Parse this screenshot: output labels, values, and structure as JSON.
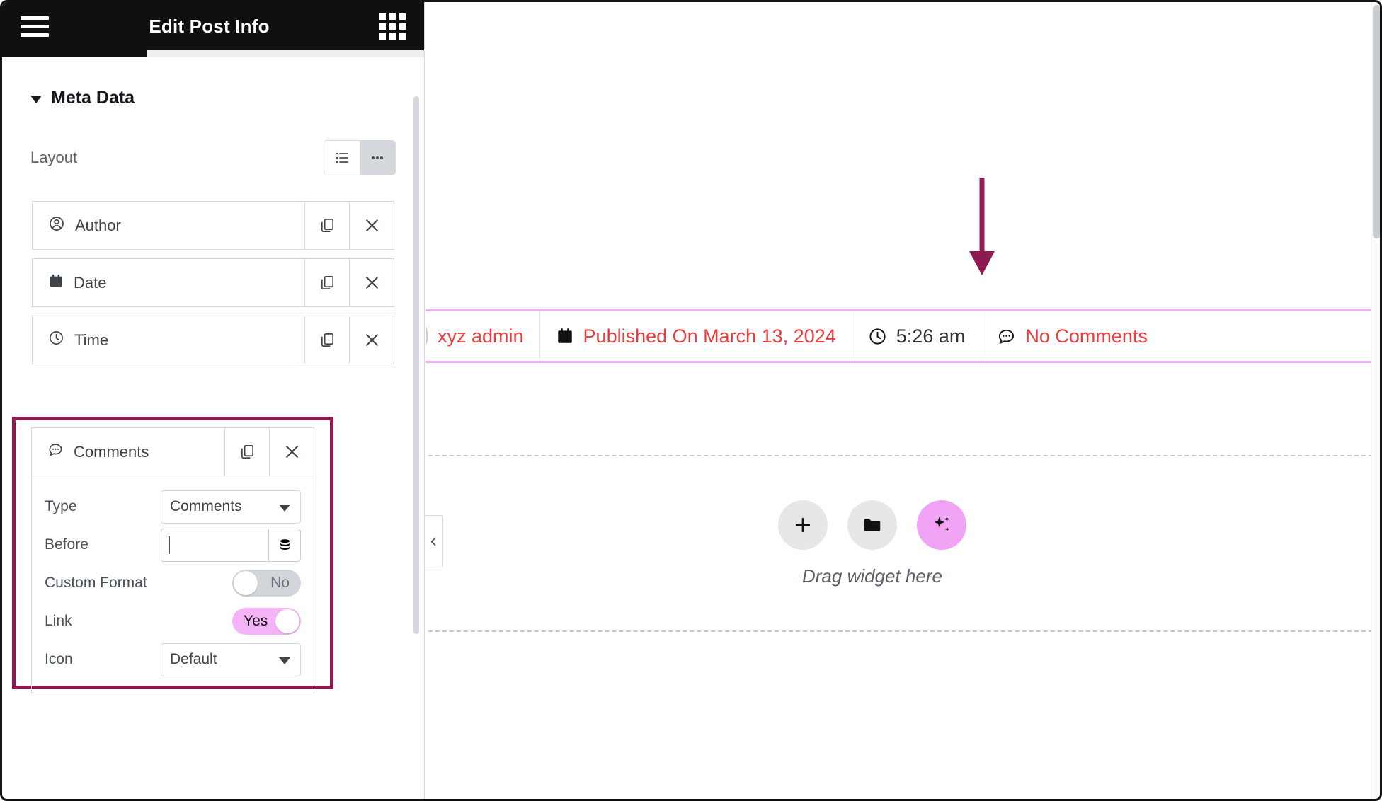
{
  "panel": {
    "header": {
      "title": "Edit Post Info",
      "menu_icon": "hamburger-icon",
      "apps_icon": "grid-apps-icon"
    },
    "section": {
      "title": "Meta Data",
      "collapse_icon": "caret-down-icon"
    },
    "layout_control": {
      "label": "Layout",
      "options": [
        {
          "name": "list-layout",
          "icon": "list-icon",
          "active": false
        },
        {
          "name": "inline-layout",
          "icon": "ellipsis-icon",
          "active": true
        }
      ]
    },
    "repeater_items": [
      {
        "label": "Author",
        "icon": "user-circle-icon",
        "duplicate": "duplicate-icon",
        "remove": "close-icon"
      },
      {
        "label": "Date",
        "icon": "calendar-icon",
        "duplicate": "duplicate-icon",
        "remove": "close-icon"
      },
      {
        "label": "Time",
        "icon": "clock-icon",
        "duplicate": "duplicate-icon",
        "remove": "close-icon"
      },
      {
        "label": "Comments",
        "icon": "comment-icon",
        "duplicate": "duplicate-icon",
        "remove": "close-icon"
      }
    ],
    "comments_settings": {
      "type": {
        "label": "Type",
        "value": "Comments"
      },
      "before": {
        "label": "Before",
        "value": "",
        "placeholder": "",
        "dynamic_icon": "database-icon"
      },
      "custom_format": {
        "label": "Custom Format",
        "value": "No",
        "on": false
      },
      "link": {
        "label": "Link",
        "value": "Yes",
        "on": true
      },
      "icon": {
        "label": "Icon",
        "value": "Default"
      }
    },
    "highlight_color": "#8e1a51",
    "collapse_handle_icon": "chevron-left-icon"
  },
  "canvas": {
    "annotation": {
      "type": "arrow-down",
      "color": "#8e1a51"
    },
    "meta_bar": {
      "outline_color": "#f0b0f5",
      "items": [
        {
          "name": "author",
          "icon": "avatar-image",
          "text": "xyz admin",
          "color": "#ef3b3b"
        },
        {
          "name": "date",
          "icon": "calendar-icon",
          "text": "Published On March 13, 2024",
          "color": "#ef3b3b"
        },
        {
          "name": "time",
          "icon": "clock-icon",
          "text": "5:26 am",
          "color": "#2f3338"
        },
        {
          "name": "comments",
          "icon": "comment-icon",
          "text": "No Comments",
          "color": "#ef3b3b"
        }
      ]
    },
    "dropzone": {
      "text": "Drag widget here",
      "buttons": [
        {
          "name": "add-widget-button",
          "icon": "plus-icon"
        },
        {
          "name": "open-library-button",
          "icon": "folder-icon"
        },
        {
          "name": "ai-button",
          "icon": "sparkles-icon"
        }
      ]
    }
  }
}
